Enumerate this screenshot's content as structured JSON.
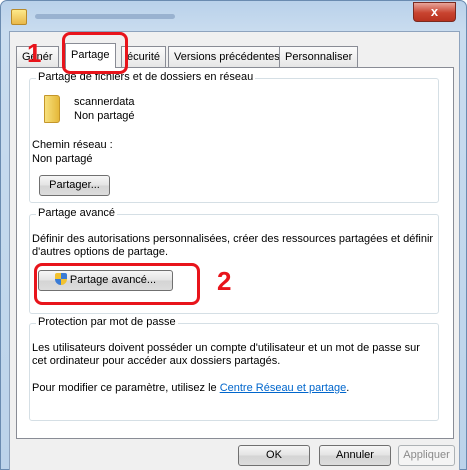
{
  "window": {
    "close_glyph": "x"
  },
  "tabs": [
    {
      "label": "Génér"
    },
    {
      "label": "Partage"
    },
    {
      "label": "écurité"
    },
    {
      "label": "Versions précédentes"
    },
    {
      "label": "Personnaliser"
    }
  ],
  "network_sharing": {
    "title": "Partage de fichiers et de dossiers en réseau",
    "folder_name": "scannerdata",
    "folder_status": "Non partagé",
    "path_label": "Chemin réseau :",
    "path_value": "Non partagé",
    "share_button": "Partager..."
  },
  "advanced_sharing": {
    "title": "Partage avancé",
    "description_line1": "Définir des autorisations personnalisées, créer des ressources partagées et définir",
    "description_line2": "d'autres options de partage.",
    "button": "Partage avancé..."
  },
  "password_protection": {
    "title": "Protection par mot de passe",
    "line1": "Les utilisateurs doivent posséder un compte d'utilisateur et un mot de passe sur",
    "line2": "cet ordinateur pour accéder aux dossiers partagés.",
    "line3_prefix": "Pour modifier ce paramètre, utilisez le ",
    "link": "Centre Réseau et partage",
    "line3_suffix": "."
  },
  "footer": {
    "ok": "OK",
    "cancel": "Annuler",
    "apply": "Appliquer"
  },
  "annotations": {
    "step1": "1",
    "step2": "2",
    "color": "#e8141b"
  }
}
